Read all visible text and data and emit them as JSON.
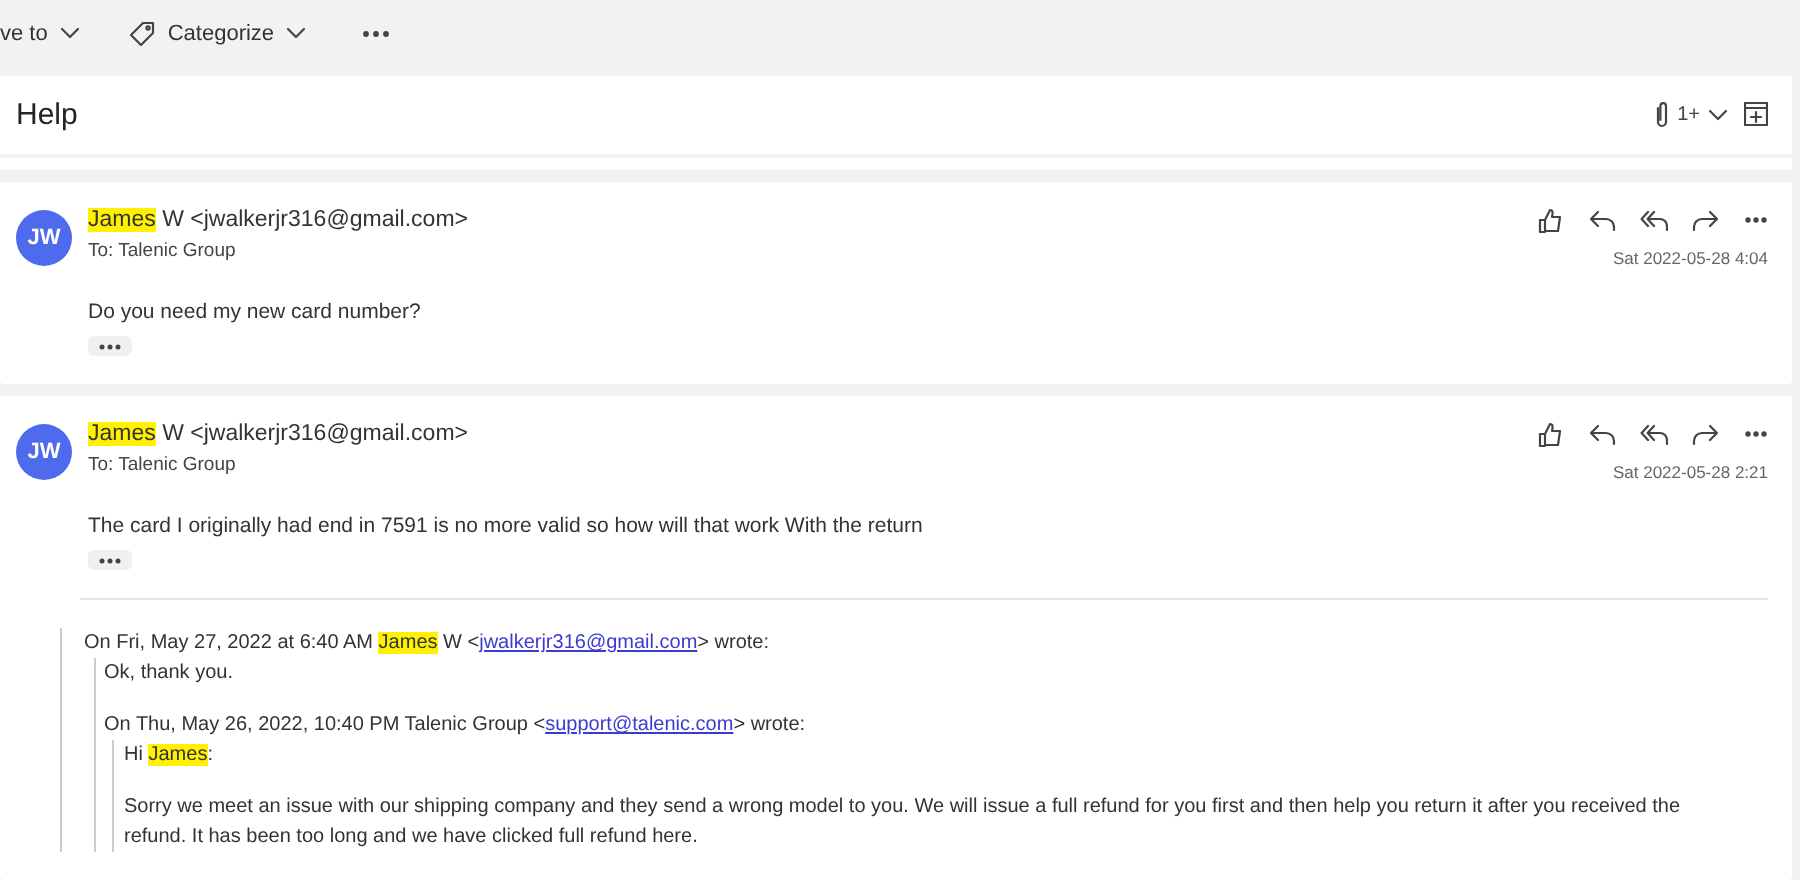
{
  "toolbar": {
    "items": [
      {
        "kind": "move",
        "label": "ve to"
      },
      {
        "kind": "categorize",
        "label": "Categorize"
      }
    ]
  },
  "subject": {
    "title": "Help",
    "attachment_count": "1+"
  },
  "messages": [
    {
      "initials": "JW",
      "sender": [
        {
          "kind": "highlight",
          "text": "James"
        },
        {
          "kind": "text",
          "text": " W <jwalkerjr316@gmail.com>"
        }
      ],
      "to": "To:  Talenic Group",
      "date": "Sat 2022-05-28 4:04",
      "body": "Do you need my new card number?"
    },
    {
      "initials": "JW",
      "sender": [
        {
          "kind": "highlight",
          "text": "James"
        },
        {
          "kind": "text",
          "text": " W <jwalkerjr316@gmail.com>"
        }
      ],
      "to": "To:  Talenic Group",
      "date": "Sat 2022-05-28 2:21",
      "body": "The card I originally had end in 7591 is no more valid so how will that work With the return",
      "quote": {
        "header": [
          {
            "kind": "text",
            "text": "On Fri, May 27, 2022 at 6:40 AM "
          },
          {
            "kind": "highlight",
            "text": "James"
          },
          {
            "kind": "text",
            "text": " W <"
          },
          {
            "kind": "link",
            "text": "jwalkerjr316@gmail.com"
          },
          {
            "kind": "text",
            "text": "> wrote:"
          }
        ],
        "lines": [
          [
            {
              "kind": "text",
              "text": "Ok, thank you."
            }
          ]
        ],
        "quote": {
          "header": [
            {
              "kind": "text",
              "text": "On Thu, May 26, 2022, 10:40 PM Talenic Group <"
            },
            {
              "kind": "link",
              "text": "support@talenic.com"
            },
            {
              "kind": "text",
              "text": "> wrote:"
            }
          ],
          "lines": [
            [
              {
                "kind": "text",
                "text": "Hi "
              },
              {
                "kind": "highlight",
                "text": "James"
              },
              {
                "kind": "text",
                "text": ":"
              }
            ],
            [
              {
                "kind": "text",
                "text": "Sorry we meet an issue with our shipping company and they send a wrong model to you. We will issue a full refund for you first and then help you return it after you received the refund. It has been too long and we have clicked full refund here."
              }
            ]
          ]
        }
      }
    }
  ]
}
